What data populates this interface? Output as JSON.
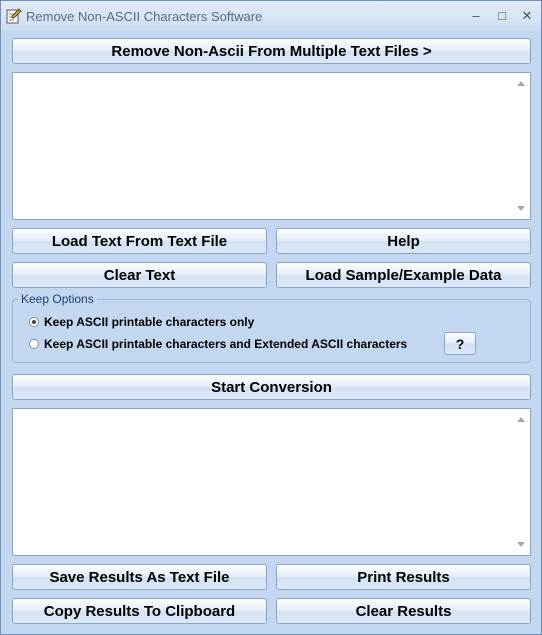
{
  "window": {
    "title": "Remove Non-ASCII Characters Software",
    "controls": {
      "minimize": "–",
      "maximize": "□",
      "close": "✕"
    },
    "icon": "pencil-document-icon"
  },
  "top_button": "Remove Non-Ascii From Multiple Text Files >",
  "input_area": {
    "value": ""
  },
  "buttons": {
    "load_text": "Load Text From Text File",
    "help": "Help",
    "clear_text": "Clear Text",
    "load_sample": "Load Sample/Example Data",
    "start_conversion": "Start Conversion",
    "save_results": "Save Results As Text File",
    "print_results": "Print Results",
    "copy_results": "Copy Results To Clipboard",
    "clear_results": "Clear Results",
    "question": "?"
  },
  "keep_options": {
    "legend": "Keep Options",
    "options": [
      {
        "label": "Keep ASCII printable characters only",
        "selected": true
      },
      {
        "label": "Keep ASCII printable characters and Extended ASCII characters",
        "selected": false
      }
    ]
  },
  "output_area": {
    "value": ""
  },
  "colors": {
    "window_bg": "#c4d7f0",
    "legend_text": "#1f3f78"
  }
}
